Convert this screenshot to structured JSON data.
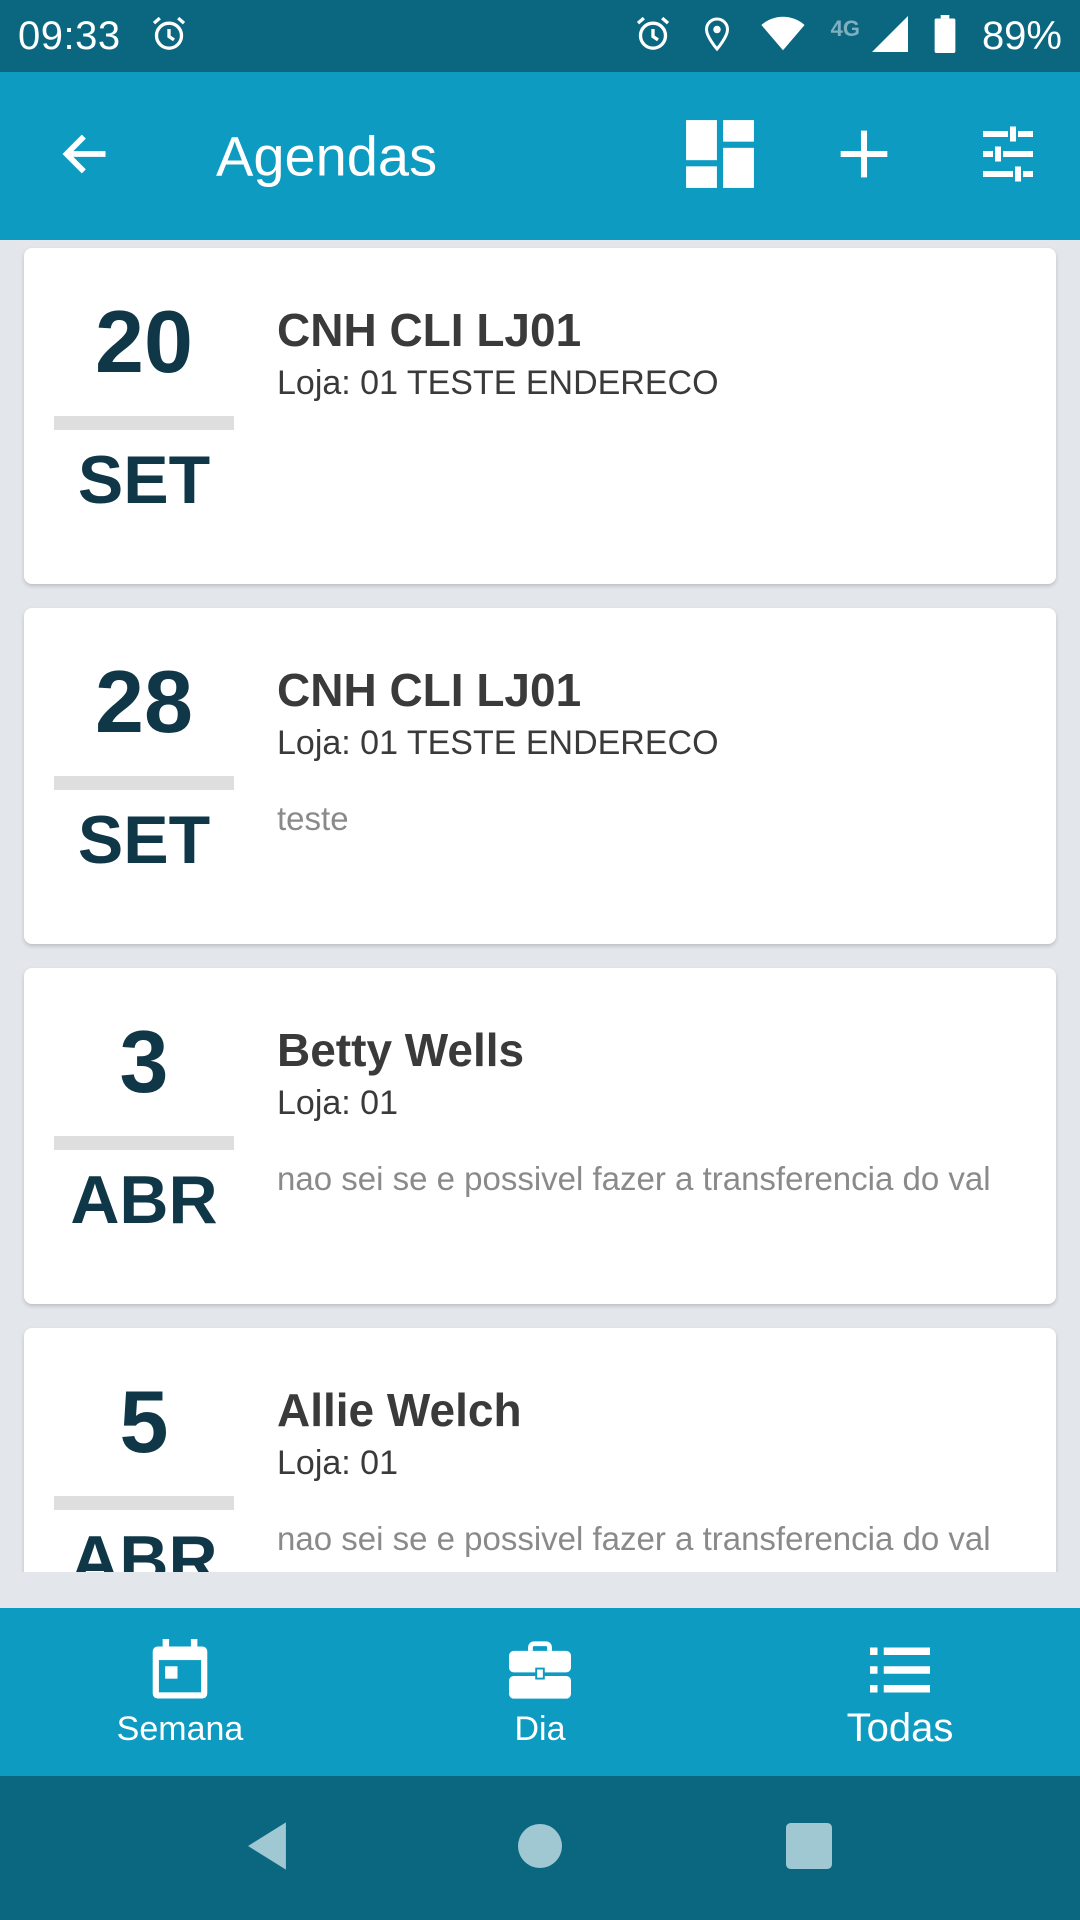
{
  "status_bar": {
    "time": "09:33",
    "network_label": "4G",
    "battery": "89%",
    "icons": [
      "alarm-icon",
      "alarm-icon",
      "location-icon",
      "wifi-icon",
      "signal-icon",
      "battery-icon"
    ]
  },
  "app_bar": {
    "title": "Agendas",
    "back_icon": "arrow-back-icon",
    "actions": [
      "dashboard-icon",
      "add-icon",
      "tune-icon"
    ]
  },
  "agendas": [
    {
      "day": "20",
      "month": "SET",
      "title": "CNH CLI LJ01",
      "subtitle": "Loja: 01 TESTE ENDERECO",
      "note": ""
    },
    {
      "day": "28",
      "month": "SET",
      "title": "CNH CLI LJ01",
      "subtitle": "Loja: 01 TESTE ENDERECO",
      "note": "teste"
    },
    {
      "day": "3",
      "month": "ABR",
      "title": "Betty Wells",
      "subtitle": "Loja: 01",
      "note": "nao sei se e possivel fazer a transferencia do val"
    },
    {
      "day": "5",
      "month": "ABR",
      "title": "Allie Welch",
      "subtitle": "Loja: 01",
      "note": "nao sei se e possivel fazer a transferencia do val"
    }
  ],
  "bottom_nav": {
    "items": [
      {
        "label": "Semana",
        "icon": "calendar-icon",
        "active": false
      },
      {
        "label": "Dia",
        "icon": "briefcase-icon",
        "active": false
      },
      {
        "label": "Todas",
        "icon": "list-icon",
        "active": true
      }
    ]
  },
  "colors": {
    "status_bar": "#0b6680",
    "app_bar": "#0e9bc2",
    "background": "#e3e7eb",
    "date_text": "#0f3747",
    "title_text": "#3a3a3a",
    "note_text": "#8a8a8a"
  }
}
